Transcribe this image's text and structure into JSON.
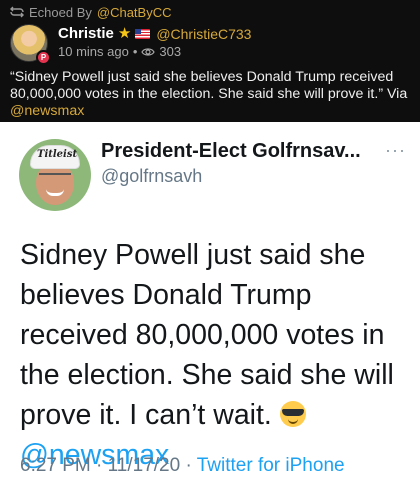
{
  "echo": {
    "prefix": "Echoed By",
    "by": "@ChatByCC"
  },
  "author": {
    "name": "Christie",
    "handle": "@ChristieC733",
    "badge": "P",
    "time": "10 mins ago",
    "separator": "•",
    "views": "303"
  },
  "post": {
    "text": "“Sidney Powell just said she believes Donald Trump received 80,000,000 votes in the election. She said she will prove it.” Via ",
    "via_handle": "@newsmax"
  },
  "tweet": {
    "name": "President-Elect Golfrnsav...",
    "handle": "@golfrnsavh",
    "more": "···",
    "avatar_cap_text": "Titleist",
    "body": "Sidney Powell just said she believes Donald Trump received 80,000,000 votes in the election. She said she will prove it. I can’t wait. ",
    "mention": "@newsmax",
    "timestamp": "6:27 PM · 11/17/20 · ",
    "source": "Twitter for iPhone"
  },
  "colors": {
    "accent_gold": "#d6a93b",
    "twitter_blue": "#1da1f2",
    "muted_gray": "#657786"
  },
  "icons": [
    "echo-icon",
    "star-icon",
    "us-flag-icon",
    "eye-icon",
    "more-options-icon",
    "sunglasses-emoji-icon"
  ]
}
